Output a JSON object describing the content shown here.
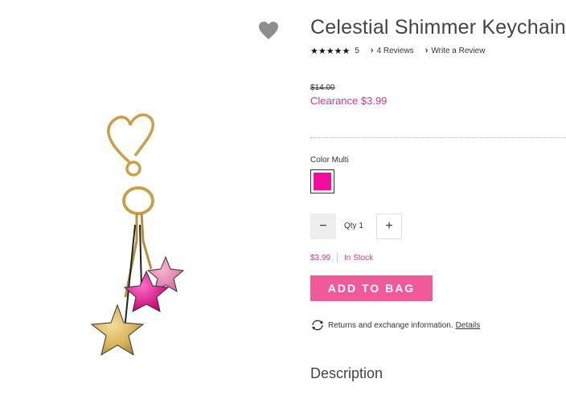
{
  "product": {
    "title": "Celestial Shimmer Keychain",
    "rating_stars": "★★★★★",
    "rating_count": "5",
    "reviews_link": "4 Reviews",
    "write_review_link": "Write a Review",
    "original_price": "$14.00",
    "sale_price": "Clearance $3.99",
    "color_label": "Color Multi",
    "swatch_color": "#f20d9c",
    "qty_label": "Qty 1",
    "minus": "−",
    "plus": "+",
    "price": "$3.99",
    "stock": "In Stock",
    "add_to_bag": "ADD TO BAG",
    "returns_text": "Returns and exchange information.",
    "details_link": "Details",
    "description_heading": "Description"
  },
  "colors": {
    "accent": "#d43a8e",
    "button": "#ef5a9b",
    "favorite_heart": "#8e8e8e"
  },
  "icons": {
    "favorite": "heart-icon",
    "returns": "refresh-icon"
  }
}
